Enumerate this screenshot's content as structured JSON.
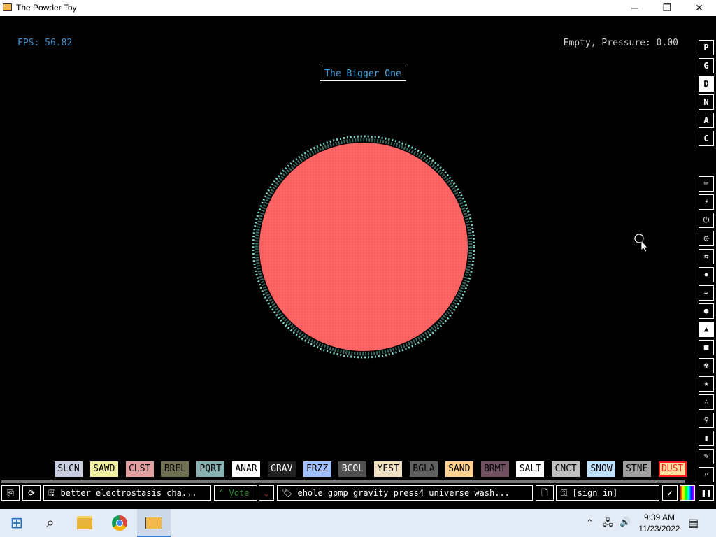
{
  "window": {
    "title": "The Powder Toy",
    "minimize_glyph": "─",
    "maximize_glyph": "❐",
    "close_glyph": "✕"
  },
  "hud": {
    "fps": "FPS: 56.82",
    "status": "Empty, Pressure: 0.00",
    "save_name": "The Bigger One"
  },
  "right_menu": [
    {
      "label": "P"
    },
    {
      "label": "G"
    },
    {
      "label": "D"
    },
    {
      "label": "N"
    },
    {
      "label": "A"
    },
    {
      "label": "C"
    }
  ],
  "categories": [
    {
      "icon": "keyboard-icon",
      "glyph": "⌨"
    },
    {
      "icon": "plug-icon",
      "glyph": "⚡"
    },
    {
      "icon": "power-icon",
      "glyph": "⏻"
    },
    {
      "icon": "sensor-icon",
      "glyph": "◎"
    },
    {
      "icon": "force-icon",
      "glyph": "⇆"
    },
    {
      "icon": "explosive-icon",
      "glyph": "✸"
    },
    {
      "icon": "gas-icon",
      "glyph": "≈"
    },
    {
      "icon": "liquid-icon",
      "glyph": "●"
    },
    {
      "icon": "powder-icon",
      "glyph": "▲"
    },
    {
      "icon": "solid-icon",
      "glyph": "■"
    },
    {
      "icon": "radioactive-icon",
      "glyph": "☢"
    },
    {
      "icon": "special-icon",
      "glyph": "★"
    },
    {
      "icon": "life-icon",
      "glyph": "∴"
    },
    {
      "icon": "tools-icon",
      "glyph": "♀"
    },
    {
      "icon": "favorites-icon",
      "glyph": "▮"
    },
    {
      "icon": "decoration-icon",
      "glyph": "✎"
    },
    {
      "icon": "search-icon",
      "glyph": "⌕"
    }
  ],
  "elements": [
    {
      "label": "SLCN",
      "bg": "#c8cde0",
      "fg": "#000000"
    },
    {
      "label": "SAWD",
      "bg": "#f0f0a0",
      "fg": "#000000"
    },
    {
      "label": "CLST",
      "bg": "#e0a0a0",
      "fg": "#000000"
    },
    {
      "label": "BREL",
      "bg": "#707050",
      "fg": "#000000"
    },
    {
      "label": "PQRT",
      "bg": "#88b0b0",
      "fg": "#000000"
    },
    {
      "label": "ANAR",
      "bg": "#ffffff",
      "fg": "#000000"
    },
    {
      "label": "GRAV",
      "bg": "#202020",
      "fg": "#ffffff"
    },
    {
      "label": "FRZZ",
      "bg": "#a0c0ff",
      "fg": "#000000"
    },
    {
      "label": "BCOL",
      "bg": "#505050",
      "fg": "#ffffff"
    },
    {
      "label": "YEST",
      "bg": "#eee0c0",
      "fg": "#000000"
    },
    {
      "label": "BGLA",
      "bg": "#606060",
      "fg": "#000000"
    },
    {
      "label": "SAND",
      "bg": "#ffd090",
      "fg": "#000000"
    },
    {
      "label": "BRMT",
      "bg": "#705060",
      "fg": "#000000"
    },
    {
      "label": "SALT",
      "bg": "#ffffff",
      "fg": "#000000"
    },
    {
      "label": "CNCT",
      "bg": "#c0c0c0",
      "fg": "#000000"
    },
    {
      "label": "SNOW",
      "bg": "#c0e0ff",
      "fg": "#000000"
    },
    {
      "label": "STNE",
      "bg": "#a0a0a0",
      "fg": "#000000"
    },
    {
      "label": "DUST",
      "bg": "#ffe0a0",
      "fg": "#ff2020"
    }
  ],
  "bottom_bar": {
    "open_glyph": "⎘",
    "reload_glyph": "⟳",
    "save_title": "better electrostasis cha...",
    "vote_label": "Vote",
    "upvote_glyph": "⌃",
    "downvote_glyph": "⌄",
    "tags": "ehole gpmp gravity press4 universe wash...",
    "new_glyph": "🗋",
    "sign_in": "[sign in]",
    "pause_glyph": "❚❚"
  },
  "taskbar": {
    "time": "9:39 AM",
    "date": "11/23/2022",
    "start_glyph": "⊞",
    "search_glyph": "⌕",
    "tray_glyph": "⌃",
    "notification_glyph": "▤"
  },
  "colors": {
    "accent": "#3f8fd0",
    "ball": "#ff6464",
    "ball_edge": "#7fd8c8"
  }
}
